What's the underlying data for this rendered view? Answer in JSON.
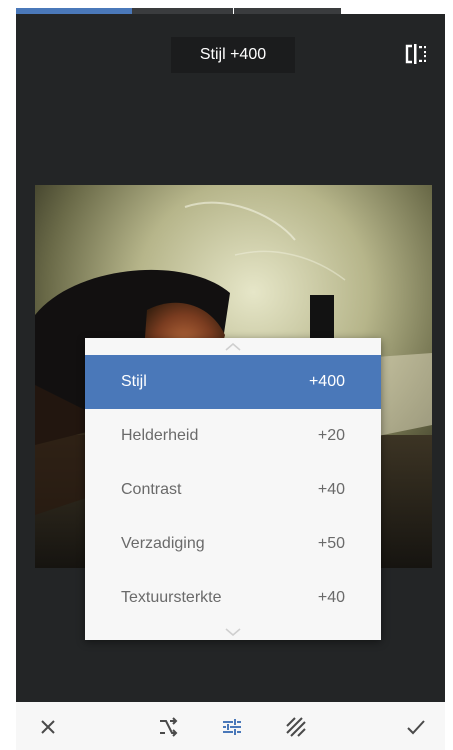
{
  "header": {
    "title": "Stijl +400"
  },
  "icons": {
    "compare": "compare-icon",
    "cancel": "close-icon",
    "shuffle": "shuffle-icon",
    "tune": "tune-icon",
    "style": "style-icon",
    "apply": "checkmark-icon",
    "scroll_up": "chevron-up-icon",
    "scroll_down": "chevron-down-icon"
  },
  "colors": {
    "accent": "#4a78b9",
    "background": "#232526",
    "menu": "#f7f7f7"
  },
  "menu": {
    "items": [
      {
        "label": "Stijl",
        "value": "+400",
        "selected": true
      },
      {
        "label": "Helderheid",
        "value": "+20",
        "selected": false
      },
      {
        "label": "Contrast",
        "value": "+40",
        "selected": false
      },
      {
        "label": "Verzadiging",
        "value": "+50",
        "selected": false
      },
      {
        "label": "Textuursterkte",
        "value": "+40",
        "selected": false
      }
    ]
  }
}
